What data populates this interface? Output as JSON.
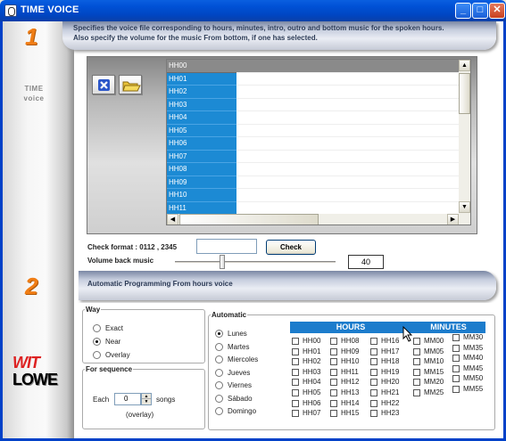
{
  "window": {
    "title": "TIME VOICE",
    "min_label": "_",
    "max_label": "□",
    "close_label": "✕"
  },
  "side": {
    "step1": "1",
    "step2": "2",
    "section1_line1": "TIME",
    "section1_line2": "voice",
    "brand1": "WIT",
    "brand2": "LOWE"
  },
  "banner1": {
    "line1": "Specifies the voice file corresponding to hours, minutes, intro, outro and bottom music for the spoken hours.",
    "line2": "Also specify the volume for the music From bottom, if one has selected."
  },
  "toolbar": {
    "delete_icon": "delete-x-icon",
    "open_icon": "open-folder-icon"
  },
  "grid": {
    "rows": [
      "HH00",
      "HH01",
      "HH02",
      "HH03",
      "HH04",
      "HH05",
      "HH06",
      "HH07",
      "HH08",
      "HH09",
      "HH10",
      "HH11"
    ],
    "up_arrow": "▲",
    "down_arrow": "▼",
    "left_arrow": "◀",
    "right_arrow": "▶"
  },
  "check": {
    "label": "Check format :  0112 , 2345",
    "input_value": "",
    "button": "Check"
  },
  "volume": {
    "label": "Volume back music",
    "value": "40",
    "level": 0.4
  },
  "banner2": {
    "text": "Automatic Programming From hours voice"
  },
  "way": {
    "legend": "Way",
    "options": [
      "Exact",
      "Near",
      "Overlay"
    ],
    "selected": "Near"
  },
  "sequence": {
    "legend": "For sequence",
    "each_label": "Each",
    "value": "0",
    "songs_label": "songs",
    "overlay_label": "(overlay)"
  },
  "automatic": {
    "legend": "Automatic",
    "days": [
      "Lunes",
      "Martes",
      "Miercoles",
      "Jueves",
      "Viernes",
      "Sábado",
      "Domingo"
    ],
    "selected_day": "Lunes",
    "hours_header": "HOURS",
    "minutes_header": "MINUTES",
    "hours_col1": [
      "HH00",
      "HH01",
      "HH02",
      "HH03",
      "HH04",
      "HH05",
      "HH06",
      "HH07"
    ],
    "hours_col2": [
      "HH08",
      "HH09",
      "HH10",
      "HH11",
      "HH12",
      "HH13",
      "HH14",
      "HH15"
    ],
    "hours_col3": [
      "HH16",
      "HH17",
      "HH18",
      "HH19",
      "HH20",
      "HH21",
      "HH22",
      "HH23"
    ],
    "minutes_col1": [
      "MM00",
      "MM05",
      "MM10",
      "MM15",
      "MM20",
      "MM25"
    ],
    "minutes_col2": [
      "MM30",
      "MM35",
      "MM40",
      "MM45",
      "MM50",
      "MM55"
    ]
  },
  "colors": {
    "accent": "#1c8ad4",
    "step_orange": "#f07d14",
    "titlebar": "#0054e3"
  }
}
